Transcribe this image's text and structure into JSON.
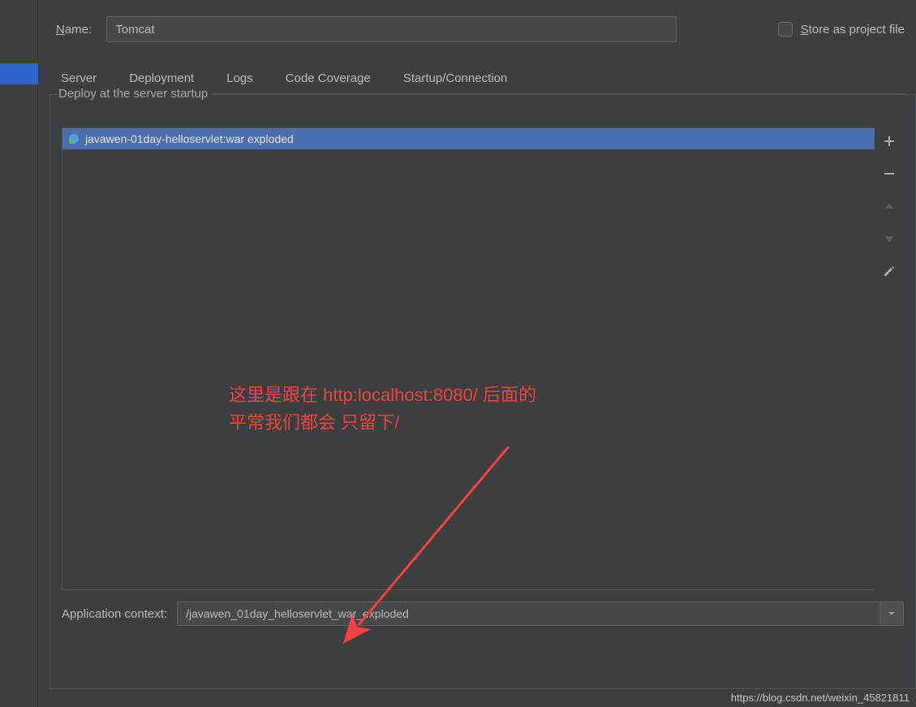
{
  "header": {
    "name_label_pre": "N",
    "name_label_post": "ame:",
    "name_value": "Tomcat",
    "store_checkbox_checked": false,
    "store_label_pre": "S",
    "store_label_post": "tore as project file"
  },
  "tabs": [
    {
      "id": "server",
      "label": "Server",
      "active": false
    },
    {
      "id": "deployment",
      "label": "Deployment",
      "active": true
    },
    {
      "id": "logs",
      "label": "Logs",
      "active": false
    },
    {
      "id": "code-coverage",
      "label": "Code Coverage",
      "active": false
    },
    {
      "id": "startup",
      "label": "Startup/Connection",
      "active": false
    }
  ],
  "group": {
    "title": "Deploy at the server startup"
  },
  "deploy_list": [
    {
      "icon": "artifact",
      "label": "javawen-01day-helloservlet:war exploded",
      "selected": true
    }
  ],
  "toolbar": {
    "add": "＋",
    "remove": "－"
  },
  "context": {
    "label": "Application context:",
    "value": "/javawen_01day_helloservlet_war_exploded"
  },
  "annotation": {
    "line1": "这里是跟在 http:localhost:8080/  后面的",
    "line2": "平常我们都会 只留下/"
  },
  "watermark": "https://blog.csdn.net/weixin_45821811"
}
